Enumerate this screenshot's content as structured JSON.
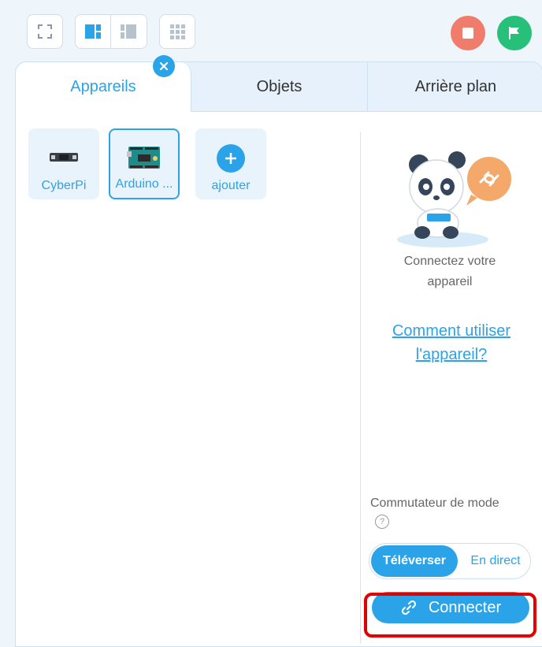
{
  "toolbar": {
    "icons": [
      "fullscreen-icon",
      "layout-split-icon",
      "layout-narrow-icon",
      "grid-icon"
    ],
    "stop_color": "#f07d6b",
    "go_color": "#27c07a"
  },
  "tabs": [
    {
      "label": "Appareils",
      "active": true
    },
    {
      "label": "Objets",
      "active": false
    },
    {
      "label": "Arrière plan",
      "active": false
    }
  ],
  "devices": [
    {
      "label": "CyberPi",
      "icon": "cyberpi-icon",
      "selected": false
    },
    {
      "label": "Arduino ...",
      "icon": "arduino-board-icon",
      "selected": true
    },
    {
      "label": "ajouter",
      "icon": "add-icon",
      "selected": false
    }
  ],
  "connect_panel": {
    "message": "Connectez votre appareil",
    "help_link": "Comment utiliser l'appareil?",
    "mode_label": "Commutateur de mode",
    "mode_help": "?",
    "mode_on": "Téléverser",
    "mode_off": "En direct",
    "connect_label": "Connecter"
  },
  "colors": {
    "accent": "#2ba3e8",
    "highlight": "#e00000"
  }
}
